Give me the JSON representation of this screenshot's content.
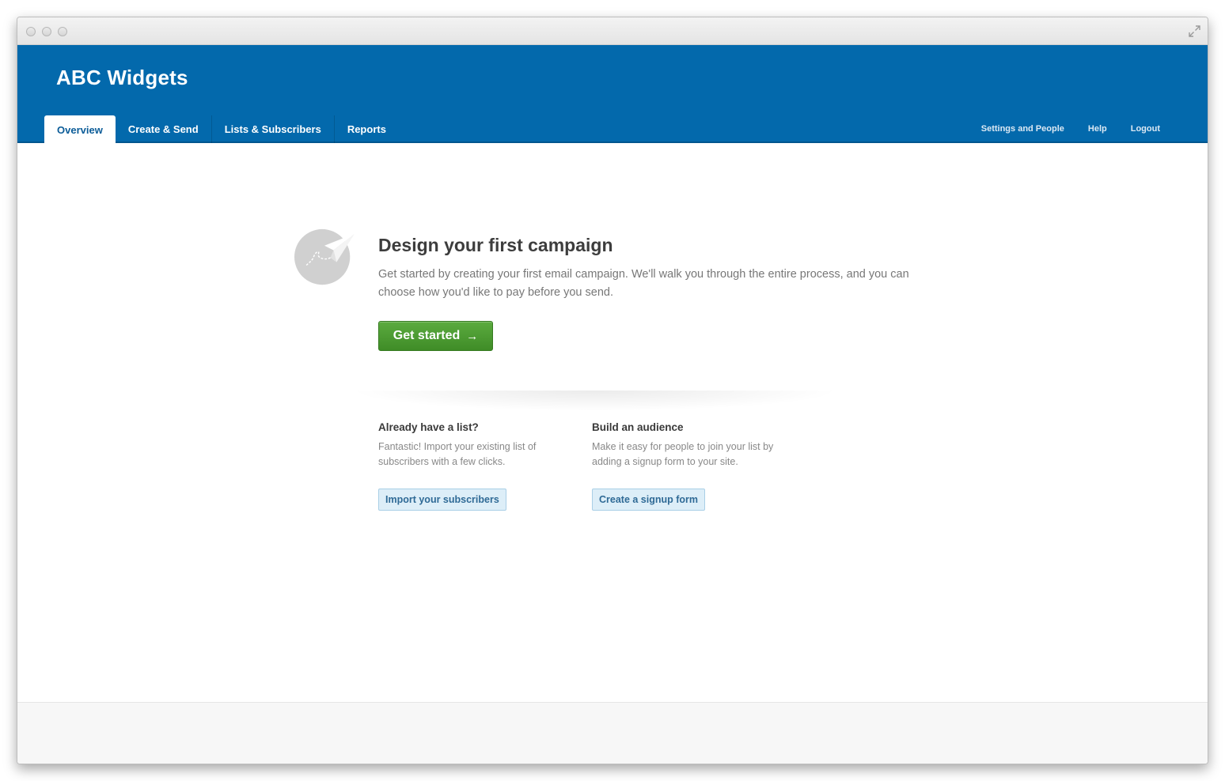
{
  "app": {
    "brand": "ABC Widgets"
  },
  "nav": {
    "tabs": [
      {
        "label": "Overview",
        "active": true
      },
      {
        "label": "Create & Send",
        "active": false
      },
      {
        "label": "Lists & Subscribers",
        "active": false
      },
      {
        "label": "Reports",
        "active": false
      }
    ],
    "utility": [
      {
        "label": "Settings and People"
      },
      {
        "label": "Help"
      },
      {
        "label": "Logout"
      }
    ]
  },
  "hero": {
    "icon": "paper-plane-icon",
    "title": "Design your first campaign",
    "text": "Get started by creating your first email campaign. We'll walk you through the entire process, and you can choose how you'd like to pay before you send.",
    "button_label": "Get started",
    "button_arrow": "→"
  },
  "columns": [
    {
      "title": "Already have a list?",
      "text": "Fantastic! Import your existing list of subscribers with a few clicks.",
      "button_label": "Import your subscribers"
    },
    {
      "title": "Build an audience",
      "text": "Make it easy for people to join your list by adding a signup form to your site.",
      "button_label": "Create a signup form"
    }
  ],
  "colors": {
    "header": "#0369ac",
    "primary_button": "#4a9a31",
    "secondary_button": "#ddeef8"
  }
}
